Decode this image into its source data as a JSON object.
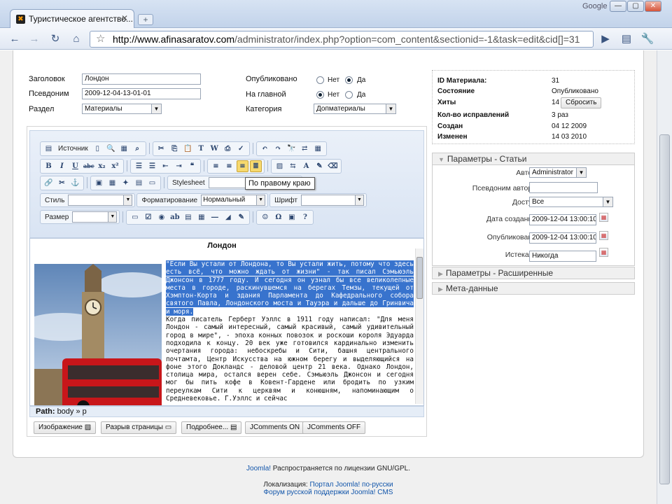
{
  "browser": {
    "tab_title": "Туристическое агентство...",
    "new_tab_symbol": "+",
    "brand": "Google",
    "url_host": "http://www.afinasaratov.com",
    "url_path": "/administrator/index.php?option=com_content&sectionid=-1&task=edit&cid[]=31"
  },
  "form": {
    "title_label": "Заголовок",
    "title_value": "Лондон",
    "alias_label": "Псевдоним",
    "alias_value": "2009-12-04-13-01-01",
    "section_label": "Раздел",
    "section_value": "Материалы",
    "published_label": "Опубликовано",
    "frontpage_label": "На главной",
    "category_label": "Категория",
    "category_value": "Допматериалы",
    "no": "Нет",
    "yes": "Да",
    "published_selected": "yes",
    "frontpage_selected": "no"
  },
  "editor": {
    "source_label": "Источник",
    "stylesheet_label": "Stylesheet",
    "style_label": "Стиль",
    "format_label": "Форматирование",
    "format_value": "Нормальный",
    "font_label": "Шрифт",
    "size_label": "Размер",
    "tooltip": "По правому краю",
    "article_title": "Лондон",
    "highlighted_text": "\"Если Вы устали от Лондона, то Вы устали жить, потому что здесь есть всё, что можно ждать от жизни\" - так писал Сэмьюэль Джонсон в 1777 году. И сегодня он узнал бы все великолепные места в городе, раскинувшемся на берегах Темзы, текущей от Хэмптон-Корта и здания Парламента до Кафедрального собора святого Павла, Лондонского моста и Тауэра и дальше до Гринвича и моря.",
    "body_text": "Когда писатель Герберт Уэллс в 1911 году написал: \"Для меня Лондон - самый интересный, самый красивый, самый удивительный город в мире\", - эпоха конных повозок и роскоши короля Эдуарда подходила к концу. 20 век уже готовился кардинально изменить очертания города: небоскребы и Сити, башня центрального почтамта, Центр Искусства на южном берегу и выделяющийся на фоне этого Докландс - деловой центр 21 века. Однако Лондон, столица мира, остался верен себе. Сэмьюэль Джонсон и сегодня мог бы пить кофе в Ковент-Гардене или бродить по узким переулкам Сити к церквям и конюшням, напоминающим о Средневековье. Г.Уэллс и сейчас",
    "path_label": "Path:",
    "path_value": "body » p",
    "buttons": [
      "Изображение",
      "Разрыв страницы",
      "Подробнее...",
      "JComments ON",
      "JComments OFF"
    ]
  },
  "info": {
    "rows": [
      {
        "k": "ID Материала:",
        "v": "31"
      },
      {
        "k": "Состояние",
        "v": "Опубликовано"
      },
      {
        "k": "Хиты",
        "v": "14"
      },
      {
        "k": "Кол-во исправлений",
        "v": "3 раз"
      },
      {
        "k": "Создан",
        "v": "04 12 2009"
      },
      {
        "k": "Изменен",
        "v": "14 03 2010"
      }
    ],
    "reset_button": "Сбросить"
  },
  "params": {
    "section_title": "Параметры - Статьи",
    "author_label": "Автор",
    "author_value": "Administrator",
    "alias_author_label": "Псевдоним автора",
    "alias_author_value": "",
    "access_label": "Доступ",
    "access_value": "Все",
    "created_label": "Дата создания",
    "created_value": "2009-12-04 13:00:10",
    "publish_label": "Опубликовано",
    "publish_value": "2009-12-04 13:00:10",
    "expires_label": "Истекает",
    "expires_value": "Никогда",
    "advanced_title": "Параметры - Расширенные",
    "meta_title": "Мета-данные"
  },
  "footer": {
    "joomla": "Joomla!",
    "license": " Распространяется по лицензии GNU/GPL.",
    "locale_label": "Локализация: ",
    "locale_link": "Портал Joomla! по-русски",
    "forum_link": "Форум русской поддержки Joomla! CMS"
  }
}
